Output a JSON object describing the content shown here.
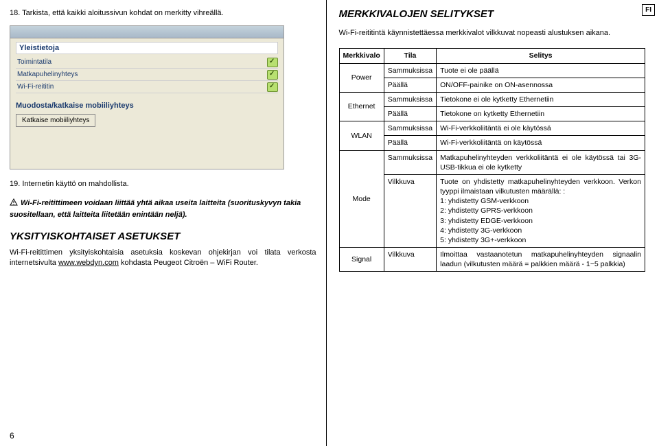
{
  "side_tab": "FI",
  "page_number": "6",
  "left": {
    "item18": "18. Tarkista, että kaikki aloitussivun kohdat on merkitty vihreällä.",
    "screenshot": {
      "window_title": "",
      "section_title": "Yleistietoja",
      "rows": [
        {
          "label": "Toimintatila"
        },
        {
          "label": "Matkapuhelinyhteys"
        },
        {
          "label": "Wi-Fi-reititin"
        }
      ],
      "sub_title": "Muodosta/katkaise mobiiliyhteys",
      "button": "Katkaise mobiiliyhteys"
    },
    "item19": "19. Internetin käyttö on mahdollista.",
    "warning": "Wi-Fi-reitittimeen voidaan liittää yhtä aikaa useita laitteita (suorituskyvyn takia suositellaan, että laitteita liitetään enintään neljä).",
    "heading_detail": "YKSITYISKOHTAISET ASETUKSET",
    "detail_para_a": "Wi-Fi-reitittimen yksityiskohtaisia asetuksia koskevan ohjekirjan voi tilata verkosta internetsivulta ",
    "detail_link": "www.webdyn.com",
    "detail_para_b": " kohdasta Peugeot Citroën – WiFi Router."
  },
  "right": {
    "heading": "MERKKIVALOJEN SELITYKSET",
    "intro": "Wi-Fi-reititintä käynnistettäessa merkkivalot vilkkuvat nopeasti alustuksen aikana.",
    "table": {
      "headers": {
        "c1": "Merkkivalo",
        "c2": "Tila",
        "c3": "Selitys"
      },
      "rows": [
        {
          "led": "Power",
          "rowspan": 2,
          "state": "Sammuksissa",
          "desc": "Tuote ei ole päällä"
        },
        {
          "state": "Päällä",
          "desc": "ON/OFF-painike on ON-asennossa"
        },
        {
          "led": "Ethernet",
          "rowspan": 2,
          "state": "Sammuksissa",
          "desc": "Tietokone ei ole kytketty Ethernetiin"
        },
        {
          "state": "Päällä",
          "desc": "Tietokone on kytketty Ethernetiin"
        },
        {
          "led": "WLAN",
          "rowspan": 2,
          "state": "Sammuksissa",
          "desc": "Wi-Fi-verkkoliitäntä ei ole käytössä"
        },
        {
          "state": "Päällä",
          "desc": "Wi-Fi-verkkoliitäntä on käytössä"
        },
        {
          "led": "Mode",
          "rowspan": 2,
          "state": "Sammuksissa",
          "desc": "Matkapuhelinyhteyden verkkoliitäntä ei ole käytössä tai 3G-USB-tikkua ei ole kytketty"
        },
        {
          "state": "Vilkkuva",
          "desc": "Tuote on yhdistetty matkapuhelinyhteyden verkkoon. Verkon tyyppi ilmaistaan vilkutusten määrällä: :\n1: yhdistetty GSM-verkkoon\n2: yhdistetty GPRS-verkkoon\n3: yhdistetty EDGE-verkkoon\n4: yhdistetty 3G-verkkoon\n5: yhdistetty 3G+-verkkoon"
        },
        {
          "led": "Signal",
          "rowspan": 1,
          "state": "Vilkkuva",
          "desc": "Ilmoittaa vastaanotetun matkapuhelinyhteyden signaalin laadun (vilkutusten määrä = palkkien määrä - 1−5 palkkia)"
        }
      ]
    }
  }
}
